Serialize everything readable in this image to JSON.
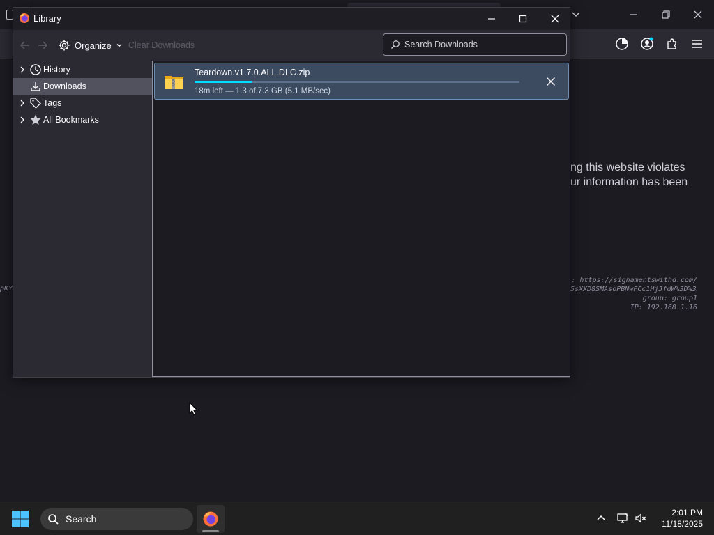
{
  "library": {
    "title": "Library",
    "organize_label": "Organize",
    "clear_downloads_label": "Clear Downloads",
    "search_placeholder": "Search Downloads",
    "sidebar": {
      "items": [
        {
          "label": "History",
          "icon": "clock-icon",
          "expandable": true,
          "selected": false
        },
        {
          "label": "Downloads",
          "icon": "download-icon",
          "expandable": false,
          "selected": true
        },
        {
          "label": "Tags",
          "icon": "tag-icon",
          "expandable": true,
          "selected": false
        },
        {
          "label": "All Bookmarks",
          "icon": "star-icon",
          "expandable": true,
          "selected": false
        }
      ]
    },
    "downloads": [
      {
        "filename": "Teardown.v1.7.0.ALL.DLC.zip",
        "status": "18m left — 1.3 of 7.3 GB (5.1 MB/sec)",
        "progress": 0.178,
        "icon": "zip-folder-icon"
      }
    ]
  },
  "background_page": {
    "warning_lines": [
      "ng this website violates",
      "ur information has been"
    ],
    "info_lines": [
      ": https://signamentswithd.com/",
      "5sXXD8SMAsoPBNwFCc1HjJfdW%3D%3D",
      "group: group1",
      "IP: 192.168.1.16"
    ],
    "left_fragment": "pKY"
  },
  "taskbar": {
    "search_label": "Search",
    "time": "2:01 PM",
    "date": "11/18/2025"
  },
  "colors": {
    "accent": "#00ddff",
    "background": "#1c1b22",
    "toolbar": "#2b2a33",
    "selection": "#52525e",
    "download_item": "#3c4b60"
  }
}
